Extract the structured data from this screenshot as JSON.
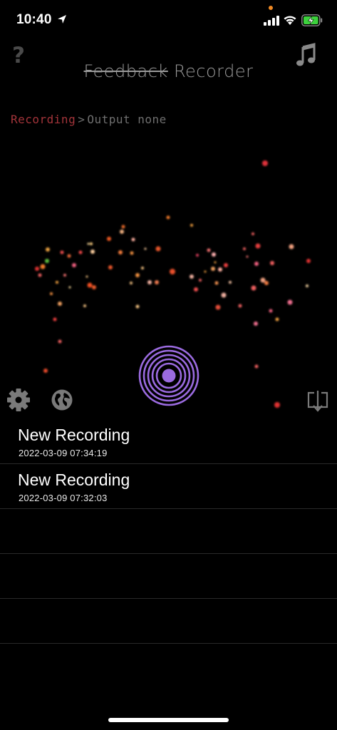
{
  "status_bar": {
    "time": "10:40",
    "icons": [
      "location-arrow-icon",
      "signal-icon",
      "wifi-icon",
      "battery-charging-icon"
    ],
    "indicator_color": "#f08a24"
  },
  "header": {
    "help_label": "?",
    "title_struck": "Feedback",
    "title_rest": "Recorder",
    "music_icon": "music-note-icon"
  },
  "breadcrumb": {
    "recording": "Recording",
    "separator": ">",
    "output": "Output none"
  },
  "toolbar": {
    "settings_icon": "gear-icon",
    "globe_icon": "globe-icon",
    "export_icon": "export-icon",
    "record_icon": "record-button-icon"
  },
  "recordings": [
    {
      "title": "New Recording",
      "date": "2022-03-09 07:34:19"
    },
    {
      "title": "New Recording",
      "date": "2022-03-09 07:32:03"
    },
    {
      "title": "",
      "date": ""
    },
    {
      "title": "",
      "date": ""
    },
    {
      "title": "",
      "date": ""
    }
  ],
  "colors": {
    "accent_purple": "#9b6be0",
    "breadcrumb_active": "#a3343a",
    "muted_text": "#6f6f6f"
  }
}
